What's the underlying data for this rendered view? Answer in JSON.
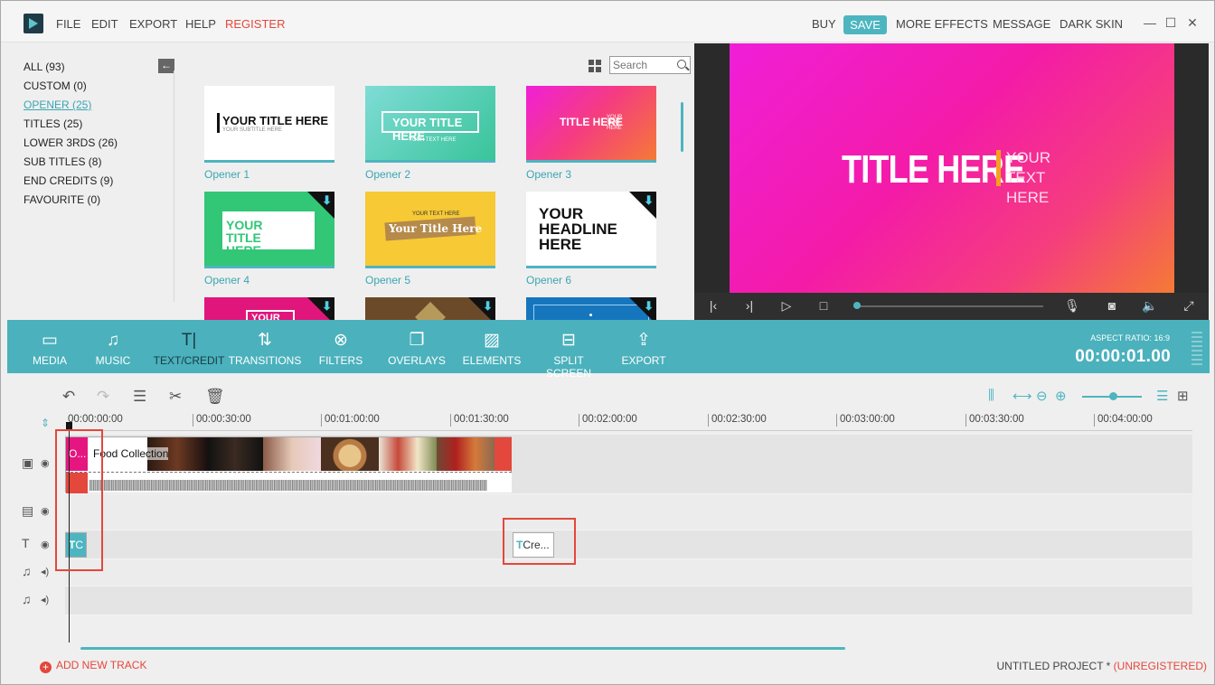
{
  "menu": {
    "file": "FILE",
    "edit": "EDIT",
    "export": "EXPORT",
    "help": "HELP",
    "register": "REGISTER"
  },
  "topright": {
    "buy": "BUY",
    "save": "SAVE",
    "more_effects": "MORE EFFECTS",
    "message": "MESSAGE",
    "dark_skin": "DARK SKIN"
  },
  "categories": [
    "ALL (93)",
    "CUSTOM (0)",
    "OPENER (25)",
    "TITLES (25)",
    "LOWER 3RDS (26)",
    "SUB TITLES (8)",
    "END CREDITS (9)",
    "FAVOURITE (0)"
  ],
  "active_category": "OPENER (25)",
  "search": {
    "placeholder": "Search"
  },
  "thumbnails": {
    "t1": {
      "label": "Opener 1",
      "text": "YOUR TITLE HERE",
      "sub": "YOUR SUBTITLE HERE"
    },
    "t2": {
      "label": "Opener 2",
      "text": "YOUR TITLE HERE",
      "sub": "YOUR TEXT HERE"
    },
    "t3": {
      "label": "Opener 3",
      "text": "TITLE HERE",
      "sub": "YOUR TEXT HERE"
    },
    "t4": {
      "label": "Opener 4",
      "text": "YOUR TITLE HERE"
    },
    "t5": {
      "label": "Opener 5",
      "text": "Your Title Here",
      "sub": "YOUR TEXT HERE"
    },
    "t6": {
      "label": "Opener 6",
      "text": "YOUR HEADLINE HERE"
    },
    "t7": {
      "text": "YOUR"
    }
  },
  "preview": {
    "title": "TITLE HERE",
    "sub": "YOUR TEXT HERE"
  },
  "tools": [
    "MEDIA",
    "MUSIC",
    "TEXT/CREDIT",
    "TRANSITIONS",
    "FILTERS",
    "OVERLAYS",
    "ELEMENTS",
    "SPLIT SCREEN",
    "EXPORT"
  ],
  "aspect_ratio": "ASPECT RATIO: 16:9",
  "timecode": "00:00:01.00",
  "ruler": [
    "00:00:00:00",
    "00:00:30:00",
    "00:01:00:00",
    "00:01:30:00",
    "00:02:00:00",
    "00:02:30:00",
    "00:03:00:00",
    "00:03:30:00",
    "00:04:00:00"
  ],
  "clips": {
    "opener": "O...",
    "food": "Food Collection",
    "title_small": "C",
    "credits": "Cre..."
  },
  "add_track": "ADD NEW TRACK",
  "project": {
    "name": "UNTITLED PROJECT *",
    "status": "(UNREGISTERED)"
  },
  "colors": {
    "accent": "#4bb1bc",
    "alert": "#e4473c"
  }
}
